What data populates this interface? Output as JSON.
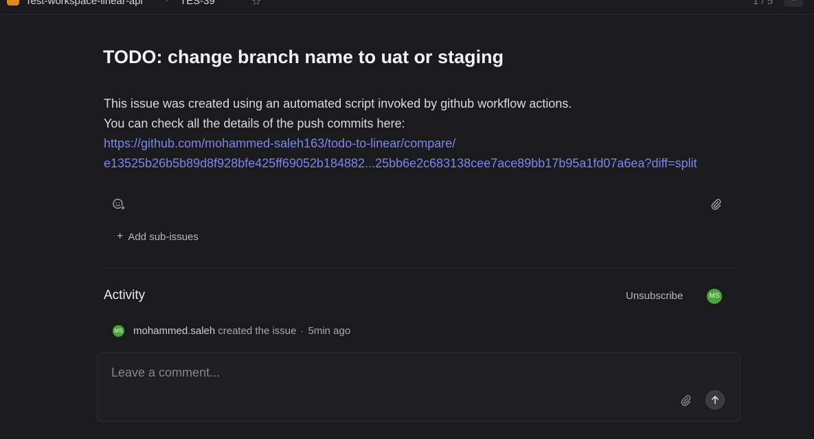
{
  "topbar": {
    "workspace_name": "Test-workspace-linear-api",
    "issue_id": "TES-39",
    "counter": "1 / 5"
  },
  "issue": {
    "title": "TODO: change branch name to uat or staging",
    "description_line1": "This issue was created using an automated script invoked by github workflow actions.",
    "description_line2": "You can check all the details of the push commits here:",
    "link_line1": "https://github.com/mohammed-saleh163/todo-to-linear/compare/",
    "link_line2": "e13525b26b5b89d8f928bfe425ff69052b184882...25bb6e2c683138cee7ace89bb17b95a1fd07a6ea?diff=split"
  },
  "actions": {
    "add_sub_issues_label": "Add sub-issues"
  },
  "activity": {
    "title": "Activity",
    "unsubscribe_label": "Unsubscribe",
    "avatar_initials": "MS",
    "events": [
      {
        "avatar_initials": "MS",
        "actor": "mohammed.saleh",
        "action": "created the issue",
        "time": "5min ago"
      }
    ]
  },
  "comment": {
    "placeholder": "Leave a comment..."
  },
  "icons": {
    "workspace": "workspace-logo-icon",
    "star": "star-icon",
    "emoji": "add-reaction-icon",
    "attach": "paperclip-icon",
    "send": "arrow-up-icon"
  },
  "colors": {
    "background": "#1b1b1e",
    "link": "#7c86ee",
    "avatar": "#4ba33a"
  }
}
